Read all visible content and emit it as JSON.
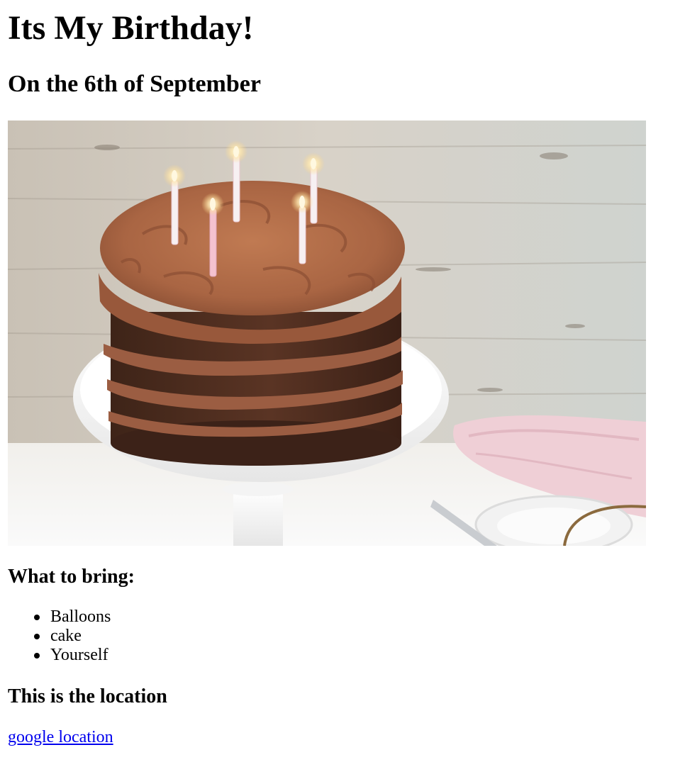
{
  "header": {
    "title": "Its My Birthday!",
    "subtitle": "On the 6th of September"
  },
  "bring": {
    "heading": "What to bring:",
    "items": [
      "Balloons",
      "cake",
      "Yourself"
    ]
  },
  "location": {
    "heading": "This is the location",
    "link_label": "google location"
  },
  "colors": {
    "link": "#0000ee",
    "text": "#000000",
    "background": "#ffffff"
  }
}
